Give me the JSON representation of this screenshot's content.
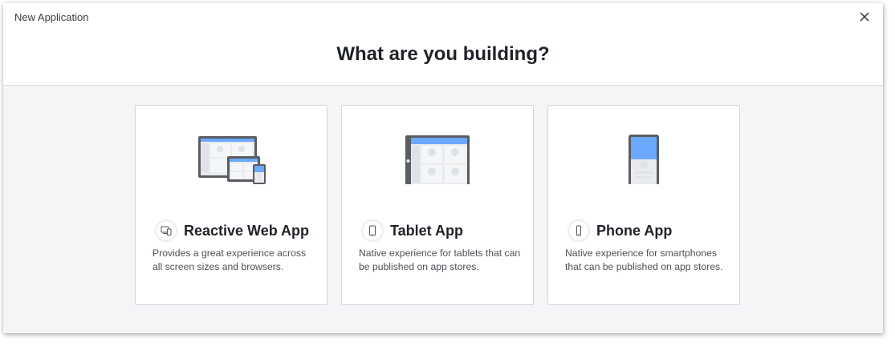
{
  "dialog": {
    "title": "New Application",
    "heading": "What are you building?"
  },
  "cards": [
    {
      "title": "Reactive Web App",
      "description": "Provides a great experience across all screen sizes and browsers.",
      "icon": "devices-icon"
    },
    {
      "title": "Tablet App",
      "description": "Native experience for tablets that can be published on app stores.",
      "icon": "tablet-icon"
    },
    {
      "title": "Phone App",
      "description": "Native experience for smartphones that can be published on app stores.",
      "icon": "phone-icon"
    }
  ],
  "colors": {
    "accent_blue": "#6aa9ff",
    "device_dark": "#5a5d62",
    "background": "#f4f5f7"
  }
}
